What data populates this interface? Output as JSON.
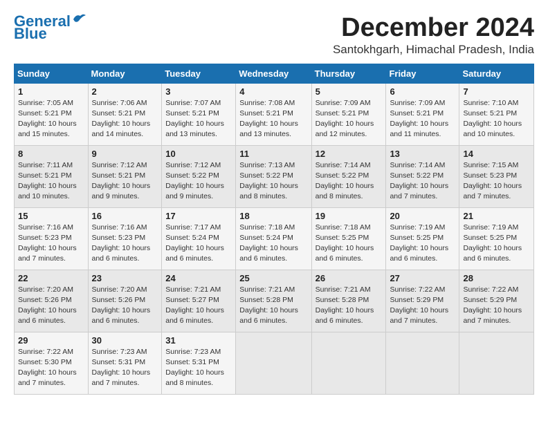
{
  "header": {
    "logo_line1": "General",
    "logo_line2": "Blue",
    "month_title": "December 2024",
    "subtitle": "Santokhgarh, Himachal Pradesh, India"
  },
  "weekdays": [
    "Sunday",
    "Monday",
    "Tuesday",
    "Wednesday",
    "Thursday",
    "Friday",
    "Saturday"
  ],
  "weeks": [
    [
      {
        "day": "1",
        "info": "Sunrise: 7:05 AM\nSunset: 5:21 PM\nDaylight: 10 hours\nand 15 minutes."
      },
      {
        "day": "2",
        "info": "Sunrise: 7:06 AM\nSunset: 5:21 PM\nDaylight: 10 hours\nand 14 minutes."
      },
      {
        "day": "3",
        "info": "Sunrise: 7:07 AM\nSunset: 5:21 PM\nDaylight: 10 hours\nand 13 minutes."
      },
      {
        "day": "4",
        "info": "Sunrise: 7:08 AM\nSunset: 5:21 PM\nDaylight: 10 hours\nand 13 minutes."
      },
      {
        "day": "5",
        "info": "Sunrise: 7:09 AM\nSunset: 5:21 PM\nDaylight: 10 hours\nand 12 minutes."
      },
      {
        "day": "6",
        "info": "Sunrise: 7:09 AM\nSunset: 5:21 PM\nDaylight: 10 hours\nand 11 minutes."
      },
      {
        "day": "7",
        "info": "Sunrise: 7:10 AM\nSunset: 5:21 PM\nDaylight: 10 hours\nand 10 minutes."
      }
    ],
    [
      {
        "day": "8",
        "info": "Sunrise: 7:11 AM\nSunset: 5:21 PM\nDaylight: 10 hours\nand 10 minutes."
      },
      {
        "day": "9",
        "info": "Sunrise: 7:12 AM\nSunset: 5:21 PM\nDaylight: 10 hours\nand 9 minutes."
      },
      {
        "day": "10",
        "info": "Sunrise: 7:12 AM\nSunset: 5:22 PM\nDaylight: 10 hours\nand 9 minutes."
      },
      {
        "day": "11",
        "info": "Sunrise: 7:13 AM\nSunset: 5:22 PM\nDaylight: 10 hours\nand 8 minutes."
      },
      {
        "day": "12",
        "info": "Sunrise: 7:14 AM\nSunset: 5:22 PM\nDaylight: 10 hours\nand 8 minutes."
      },
      {
        "day": "13",
        "info": "Sunrise: 7:14 AM\nSunset: 5:22 PM\nDaylight: 10 hours\nand 7 minutes."
      },
      {
        "day": "14",
        "info": "Sunrise: 7:15 AM\nSunset: 5:23 PM\nDaylight: 10 hours\nand 7 minutes."
      }
    ],
    [
      {
        "day": "15",
        "info": "Sunrise: 7:16 AM\nSunset: 5:23 PM\nDaylight: 10 hours\nand 7 minutes."
      },
      {
        "day": "16",
        "info": "Sunrise: 7:16 AM\nSunset: 5:23 PM\nDaylight: 10 hours\nand 6 minutes."
      },
      {
        "day": "17",
        "info": "Sunrise: 7:17 AM\nSunset: 5:24 PM\nDaylight: 10 hours\nand 6 minutes."
      },
      {
        "day": "18",
        "info": "Sunrise: 7:18 AM\nSunset: 5:24 PM\nDaylight: 10 hours\nand 6 minutes."
      },
      {
        "day": "19",
        "info": "Sunrise: 7:18 AM\nSunset: 5:25 PM\nDaylight: 10 hours\nand 6 minutes."
      },
      {
        "day": "20",
        "info": "Sunrise: 7:19 AM\nSunset: 5:25 PM\nDaylight: 10 hours\nand 6 minutes."
      },
      {
        "day": "21",
        "info": "Sunrise: 7:19 AM\nSunset: 5:25 PM\nDaylight: 10 hours\nand 6 minutes."
      }
    ],
    [
      {
        "day": "22",
        "info": "Sunrise: 7:20 AM\nSunset: 5:26 PM\nDaylight: 10 hours\nand 6 minutes."
      },
      {
        "day": "23",
        "info": "Sunrise: 7:20 AM\nSunset: 5:26 PM\nDaylight: 10 hours\nand 6 minutes."
      },
      {
        "day": "24",
        "info": "Sunrise: 7:21 AM\nSunset: 5:27 PM\nDaylight: 10 hours\nand 6 minutes."
      },
      {
        "day": "25",
        "info": "Sunrise: 7:21 AM\nSunset: 5:28 PM\nDaylight: 10 hours\nand 6 minutes."
      },
      {
        "day": "26",
        "info": "Sunrise: 7:21 AM\nSunset: 5:28 PM\nDaylight: 10 hours\nand 6 minutes."
      },
      {
        "day": "27",
        "info": "Sunrise: 7:22 AM\nSunset: 5:29 PM\nDaylight: 10 hours\nand 7 minutes."
      },
      {
        "day": "28",
        "info": "Sunrise: 7:22 AM\nSunset: 5:29 PM\nDaylight: 10 hours\nand 7 minutes."
      }
    ],
    [
      {
        "day": "29",
        "info": "Sunrise: 7:22 AM\nSunset: 5:30 PM\nDaylight: 10 hours\nand 7 minutes."
      },
      {
        "day": "30",
        "info": "Sunrise: 7:23 AM\nSunset: 5:31 PM\nDaylight: 10 hours\nand 7 minutes."
      },
      {
        "day": "31",
        "info": "Sunrise: 7:23 AM\nSunset: 5:31 PM\nDaylight: 10 hours\nand 8 minutes."
      },
      {
        "day": "",
        "info": ""
      },
      {
        "day": "",
        "info": ""
      },
      {
        "day": "",
        "info": ""
      },
      {
        "day": "",
        "info": ""
      }
    ]
  ]
}
